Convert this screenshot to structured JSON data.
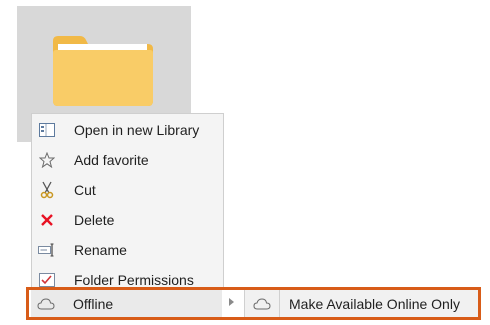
{
  "menu": {
    "items": [
      {
        "label": "Open in new Library",
        "icon": "open-library-icon"
      },
      {
        "label": "Add favorite",
        "icon": "star-outline-icon"
      },
      {
        "label": "Cut",
        "icon": "scissors-icon"
      },
      {
        "label": "Delete",
        "icon": "red-x-icon"
      },
      {
        "label": "Rename",
        "icon": "rename-icon"
      },
      {
        "label": "Folder Permissions",
        "icon": "permissions-icon"
      }
    ],
    "offline": {
      "label": "Offline",
      "icon": "cloud-icon"
    }
  },
  "submenu": {
    "items": [
      {
        "label": "Make Available Online Only",
        "icon": "cloud-icon"
      }
    ]
  },
  "colors": {
    "highlight_border": "#d85c18",
    "folder_body": "#f9cc67",
    "folder_back": "#f1b947",
    "delete_red": "#e81123",
    "menu_bg": "#f4f4f4"
  }
}
